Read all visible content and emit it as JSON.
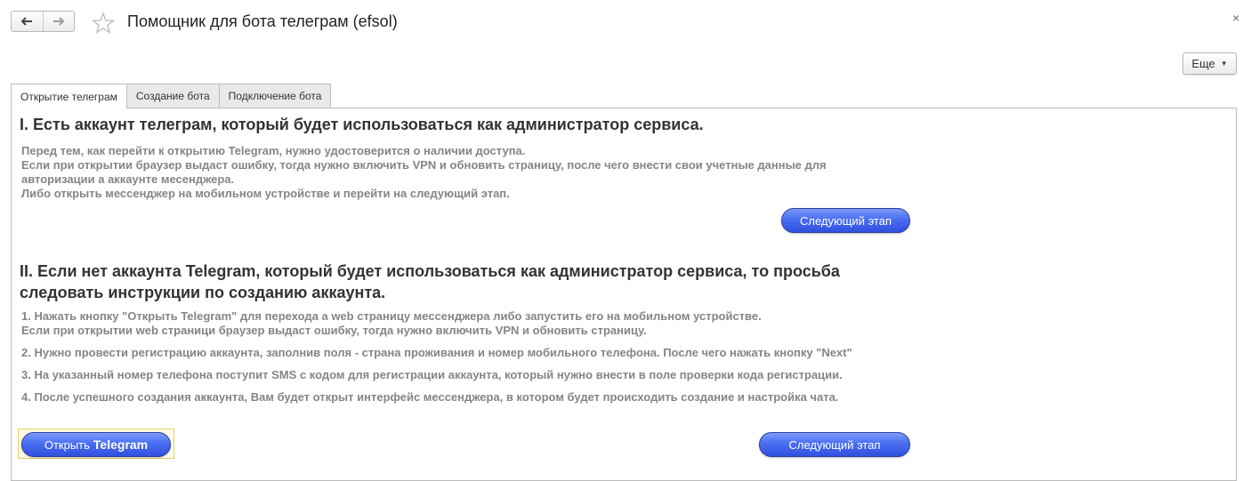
{
  "window": {
    "title": "Помощник для бота телеграм (efsol)",
    "close_glyph": "×",
    "back_icon": "arrow-left-icon",
    "forward_icon": "arrow-right-icon",
    "favorite_icon": "star-icon"
  },
  "toolbar": {
    "more_label": "Еще",
    "more_caret": "▼"
  },
  "tabs": [
    {
      "label": "Открытие телеграм",
      "active": true
    },
    {
      "label": "Создание бота",
      "active": false
    },
    {
      "label": "Подключение бота",
      "active": false
    }
  ],
  "section1": {
    "heading": "I. Есть аккаунт телеграм, который будет использоваться как администратор сервиса.",
    "lines": [
      "Перед тем, как перейти к открытию Telegram, нужно удостоверится о наличии доступа.",
      "Если при открытии браузер выдаст ошибку, тогда нужно включить VPN и обновить страницу, после чего внести свои учетные данные для",
      "авторизации а аккаунте месенджера.",
      "Либо открыть мессенджер на мобильном устройстве и перейти на следующий этап."
    ],
    "next_button": "Следующий этап"
  },
  "section2": {
    "heading": "II. Если нет аккаунта Telegram, который будет использоваться как администратор сервиса, то просьба следовать инструкции по созданию аккаунта.",
    "step1_line1": "1. Нажать кнопку \"Открыть Telegram\" для перехода а web страницу мессенджера либо запустить его на мобильном устройстве.",
    "step1_line2": "Если при открытии web страници браузер выдаст ошибку, тогда нужно включить VPN и обновить страницу.",
    "step2": "2. Нужно провести регистрацию аккаунта, заполнив поля - страна проживания и номер мобильного телефона. После чего нажать кнопку \"Next\"",
    "step3": "3. На указанный номер телефона поступит SMS с кодом для регистрации аккаунта, который нужно внести в поле проверки кода регистрации.",
    "step4": "4. После успешного создания аккаунта, Вам будет открыт интерфейс мессенджера, в котором будет происходить создание и настройка чата.",
    "open_button_prefix": "Открыть",
    "open_button_bold": "Telegram",
    "next_button": "Следующий этап"
  },
  "colors": {
    "accent_button": "#4a6ef0",
    "button_border": "#2a3ea3",
    "focus_frame": "#e8cf62",
    "muted_text": "#858585"
  }
}
